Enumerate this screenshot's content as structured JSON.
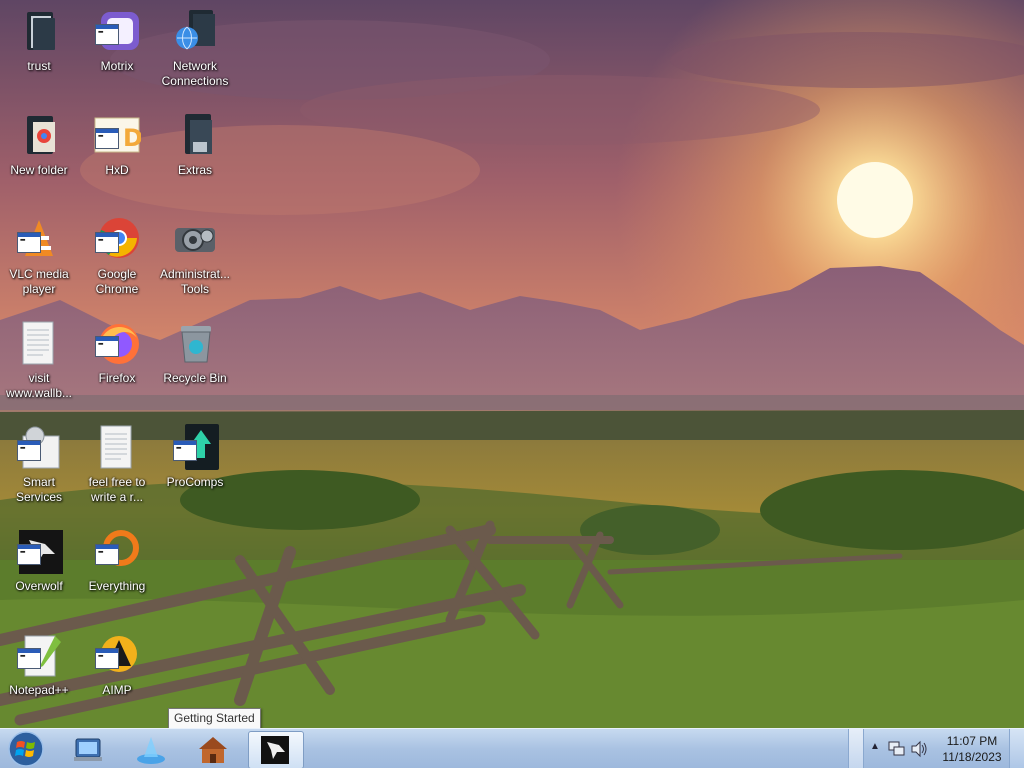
{
  "desktop": {
    "icons": [
      {
        "label": "trust",
        "icon": "folder-icon"
      },
      {
        "label": "Motrix",
        "icon": "motrix-icon"
      },
      {
        "label": "Network Connections",
        "icon": "network-connections-icon"
      },
      {
        "label": "New folder",
        "icon": "folder-icon"
      },
      {
        "label": "HxD",
        "icon": "hxd-icon"
      },
      {
        "label": "Extras",
        "icon": "folder-icon"
      },
      {
        "label": "VLC media player",
        "icon": "vlc-icon"
      },
      {
        "label": "Google Chrome",
        "icon": "chrome-icon"
      },
      {
        "label": "Administrat... Tools",
        "icon": "admin-tools-icon"
      },
      {
        "label": "visit www.wallb...",
        "icon": "text-file-icon"
      },
      {
        "label": "Firefox",
        "icon": "firefox-icon"
      },
      {
        "label": "Recycle Bin",
        "icon": "recycle-bin-icon"
      },
      {
        "label": "Smart Services",
        "icon": "smart-services-icon"
      },
      {
        "label": "feel free to write a r...",
        "icon": "text-file-icon"
      },
      {
        "label": "ProComps",
        "icon": "procomps-icon"
      },
      {
        "label": "Overwolf",
        "icon": "overwolf-icon"
      },
      {
        "label": "Everything",
        "icon": "everything-icon"
      },
      {
        "label": "Notepad++",
        "icon": "notepadpp-icon"
      },
      {
        "label": "AIMP",
        "icon": "aimp-icon"
      }
    ]
  },
  "tooltip": {
    "text": "Getting Started"
  },
  "taskbar": {
    "start_icon": "windows-orb-icon",
    "pinned": [
      {
        "name": "getting-started",
        "icon": "getting-started-icon"
      },
      {
        "name": "app-launcher",
        "icon": "app-launcher-icon"
      },
      {
        "name": "home-app",
        "icon": "home-icon"
      },
      {
        "name": "overwolf",
        "icon": "overwolf-icon",
        "active": true
      }
    ],
    "tray": {
      "time": "11:07 PM",
      "date": "11/18/2023",
      "icons": [
        "show-hidden-icons-chevron-icon",
        "network-icon",
        "volume-icon"
      ]
    }
  },
  "colors": {
    "taskbar": "#a9c2e2",
    "sky_top": "#6b4a63",
    "sun": "#fff6c8"
  }
}
